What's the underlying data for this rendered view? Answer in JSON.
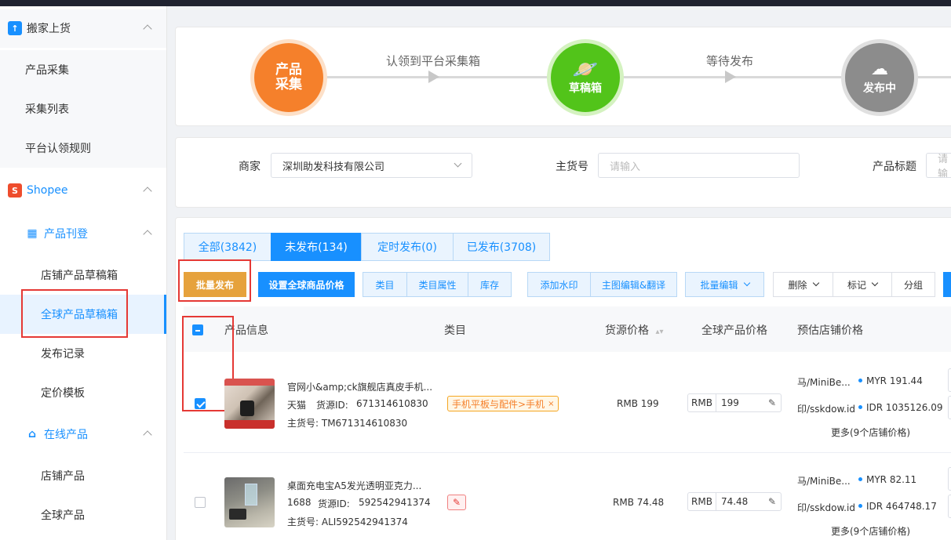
{
  "sidebar": {
    "group_move": "搬家上货",
    "items_move": [
      "产品采集",
      "采集列表",
      "平台认领规则"
    ],
    "group_shopee": "Shopee",
    "group_listing": "产品刊登",
    "items_listing": [
      "店铺产品草稿箱",
      "全球产品草稿箱",
      "发布记录",
      "定价模板"
    ],
    "group_online": "在线产品",
    "items_online": [
      "店铺产品",
      "全球产品"
    ]
  },
  "steps": {
    "step1": "产品\n采集",
    "arrow1": "认领到平台采集箱",
    "step2": "草稿箱",
    "arrow2": "等待发布",
    "step3": "发布中"
  },
  "filters": {
    "merchant_label": "商家",
    "merchant_value": "深圳助发科技有限公司",
    "sku_label": "主货号",
    "sku_placeholder": "请输入",
    "title_label": "产品标题",
    "title_placeholder": "请输"
  },
  "tabs": [
    "全部(3842)",
    "未发布(134)",
    "定时发布(0)",
    "已发布(3708)"
  ],
  "toolbar": {
    "batch_publish": "批量发布",
    "set_price": "设置全球商品价格",
    "category": "类目",
    "category_attr": "类目属性",
    "stock": "库存",
    "watermark": "添加水印",
    "main_image": "主图编辑&翻译",
    "batch_edit": "批量编辑",
    "delete": "删除",
    "mark": "标记",
    "group": "分组"
  },
  "table": {
    "headers": {
      "product_info": "产品信息",
      "category": "类目",
      "source_price": "货源价格",
      "global_price": "全球产品价格",
      "est_price": "预估店铺价格"
    },
    "rows": [
      {
        "title": "官网小&amp;ck旗舰店真皮手机...",
        "source": "天猫",
        "source_id_label": "货源ID:",
        "source_id": "671314610830",
        "sku": "主货号: TM671314610830",
        "category_tag": "手机平板与配件>手机",
        "source_price": "RMB 199",
        "price_prefix": "RMB",
        "price_value": "199",
        "shop1": "马/MiniBe...",
        "shop1_price": "MYR 191.44",
        "shop2": "印/sskdow.id",
        "shop2_price": "IDR 1035126.09",
        "more": "更多(9个店铺价格)",
        "checked": true
      },
      {
        "title": "桌面充电宝A5发光透明亚克力...",
        "source": "1688",
        "source_id_label": "货源ID:",
        "source_id": "592542941374",
        "sku": "主货号: ALI592542941374",
        "category_tag": "",
        "source_price": "RMB 74.48",
        "price_prefix": "RMB",
        "price_value": "74.48",
        "shop1": "马/MiniBe...",
        "shop1_price": "MYR 82.11",
        "shop2": "印/sskdow.id",
        "shop2_price": "IDR 464748.17",
        "more": "更多(9个店铺价格)",
        "checked": false
      }
    ]
  },
  "colors": {
    "primary": "#1890ff",
    "step1": "#f5802b",
    "step2": "#52c41a",
    "step3": "#8c8c8c",
    "batch_publish": "#e6a23c",
    "highlight_box": "#e53935"
  }
}
